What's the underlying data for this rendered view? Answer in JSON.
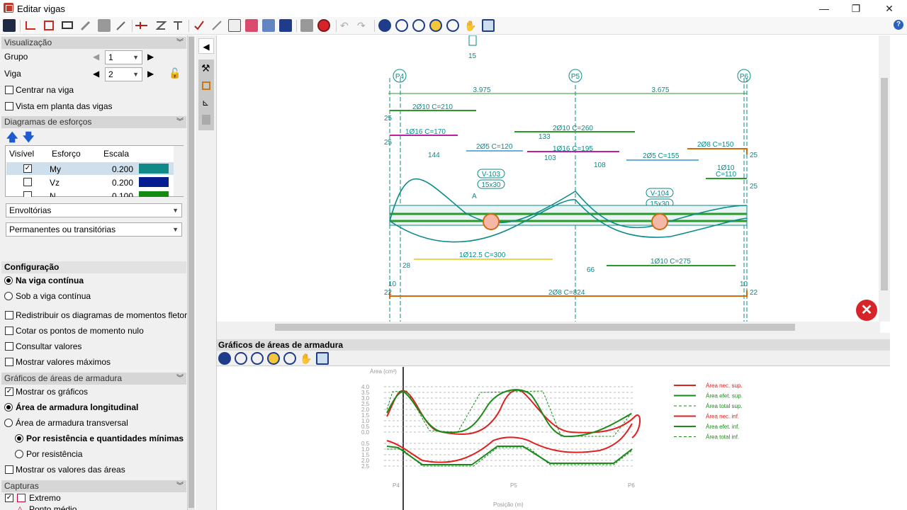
{
  "window": {
    "title": "Editar vigas",
    "minimize": "—",
    "maximize": "❐",
    "close": "✕"
  },
  "left": {
    "visualizacao": {
      "header": "Visualização",
      "grupo_label": "Grupo",
      "grupo_value": "1",
      "viga_label": "Viga",
      "viga_value": "2",
      "centrar": "Centrar na viga",
      "vista": "Vista em planta das vigas"
    },
    "diagramas": {
      "header": "Diagramas de esforços",
      "cols": [
        "Visível",
        "Esforço",
        "Escala"
      ],
      "rows": [
        {
          "esforco": "My",
          "escala": "0.200",
          "color": "#0f8a86",
          "checked": true
        },
        {
          "esforco": "Vz",
          "escala": "0.200",
          "color": "#061d8f",
          "checked": false
        },
        {
          "esforco": "N",
          "escala": "0.100",
          "color": "#138a12",
          "checked": false
        }
      ],
      "envolvente": "Envoltórias",
      "combinacao": "Permanentes ou transitórias"
    },
    "configuracao": {
      "header": "Configuração",
      "opt1": "Na viga contínua",
      "opt2": "Sob a viga contínua",
      "redistribuir": "Redistribuir os diagramas de momentos fletores",
      "cotar": "Cotar os pontos de momento nulo",
      "consultar": "Consultar valores",
      "mostrar_max": "Mostrar valores máximos"
    },
    "graficos": {
      "header": "Gráficos de áreas de armadura",
      "mostrar": "Mostrar os gráficos",
      "long": "Área de armadura longitudinal",
      "transv": "Área de armadura transversal",
      "resmin": "Por resistência e quantidades mínimas",
      "res": "Por resistência",
      "valores": "Mostrar os valores das áreas"
    },
    "capturas": {
      "header": "Capturas",
      "extremo": "Extremo",
      "medio": "Ponto médio"
    }
  },
  "drawing": {
    "pillars": [
      "P4",
      "P5",
      "P6"
    ],
    "spans": [
      "3.975",
      "3.675"
    ],
    "top_dim": "15",
    "labels": {
      "b1": "2Ø10 C=210",
      "b2": "1Ø16 C=170",
      "b3": "2Ø10 C=260",
      "b4": "133",
      "b5": "2Ø5 C=120",
      "b6": "1Ø16 C=195",
      "b7": "144",
      "b8": "103",
      "b9": "2Ø5 C=155",
      "b10": "2Ø8 C=150",
      "b11": "108",
      "b12": "1Ø10",
      "b12b": "C=110",
      "v1": "V-103",
      "v1s": "15x30",
      "v2": "V-104",
      "v2s": "15x30",
      "secA": "A",
      "bot1": "1Ø12.5 C=300",
      "bot2": "28",
      "bot3": "66",
      "bot4": "1Ø10 C=275",
      "bot5": "2Ø8 C=824",
      "d10a": "10",
      "d10b": "10",
      "d22a": "22",
      "d22b": "22",
      "d25a": "25",
      "d25b": "25",
      "d25c": "25",
      "d25d": "25"
    }
  },
  "graphs": {
    "title": "Gráficos de áreas de armadura",
    "ylabel": "Área (cm²)",
    "xlabel": "Posição (m)",
    "yticks_top": [
      "4.0",
      "3.5",
      "3.0",
      "2.5",
      "2.0",
      "1.5",
      "1.0",
      "0.5",
      "0.0"
    ],
    "yticks_bot": [
      "0.5",
      "1.0",
      "1.5",
      "2.0",
      "2.5"
    ],
    "xticks": [
      "P4",
      "P5",
      "P6"
    ],
    "legend": [
      {
        "text": "Área nec. sup.",
        "color": "#e02020",
        "dash": false
      },
      {
        "text": "Área efet. sup.",
        "color": "#1a8a1a",
        "dash": false
      },
      {
        "text": "Área total sup.",
        "color": "#1a8a1a",
        "dash": true
      },
      {
        "text": "Área nec. inf.",
        "color": "#e02020",
        "dash": false
      },
      {
        "text": "Área efet. inf.",
        "color": "#1a8a1a",
        "dash": false
      },
      {
        "text": "Área total inf.",
        "color": "#1a8a1a",
        "dash": true
      }
    ]
  }
}
